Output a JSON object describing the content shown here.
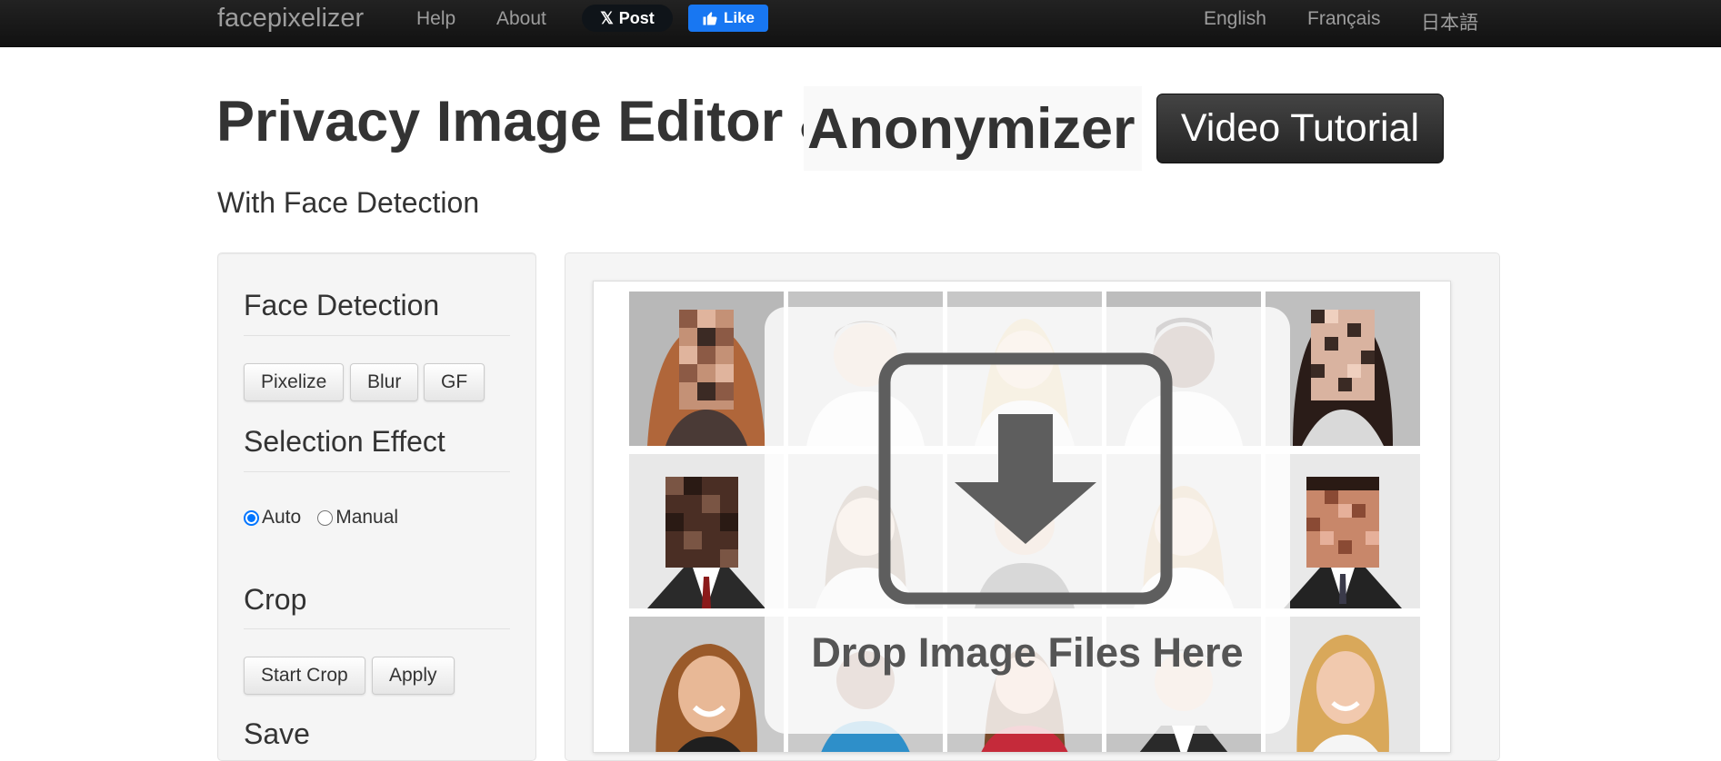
{
  "navbar": {
    "brand": "facepixelizer",
    "links": [
      "Help",
      "About"
    ],
    "x_post_label": "Post",
    "fb_like_label": "Like",
    "languages": [
      "English",
      "Français",
      "日本語"
    ]
  },
  "header": {
    "title_part1": "Privacy Image Editor &",
    "title_part2": "Anonymizer",
    "video_button": "Video Tutorial",
    "subtitle": "With Face Detection"
  },
  "sidebar": {
    "face_detection": {
      "title": "Face Detection",
      "buttons": [
        "Pixelize",
        "Blur",
        "GF"
      ]
    },
    "selection_effect": {
      "title": "Selection Effect",
      "options": [
        "Auto",
        "Manual"
      ],
      "selected": "Auto"
    },
    "crop": {
      "title": "Crop",
      "buttons": [
        "Start Crop",
        "Apply"
      ]
    },
    "save": {
      "title": "Save"
    }
  },
  "main": {
    "drop_text": "Drop Image Files Here",
    "icon": "download-arrow-icon"
  },
  "colors": {
    "navbar_bg": "#1b1b1b",
    "video_button_bg": "#333333",
    "radio_accent": "#0075ff",
    "facebook_blue": "#1877f2"
  }
}
